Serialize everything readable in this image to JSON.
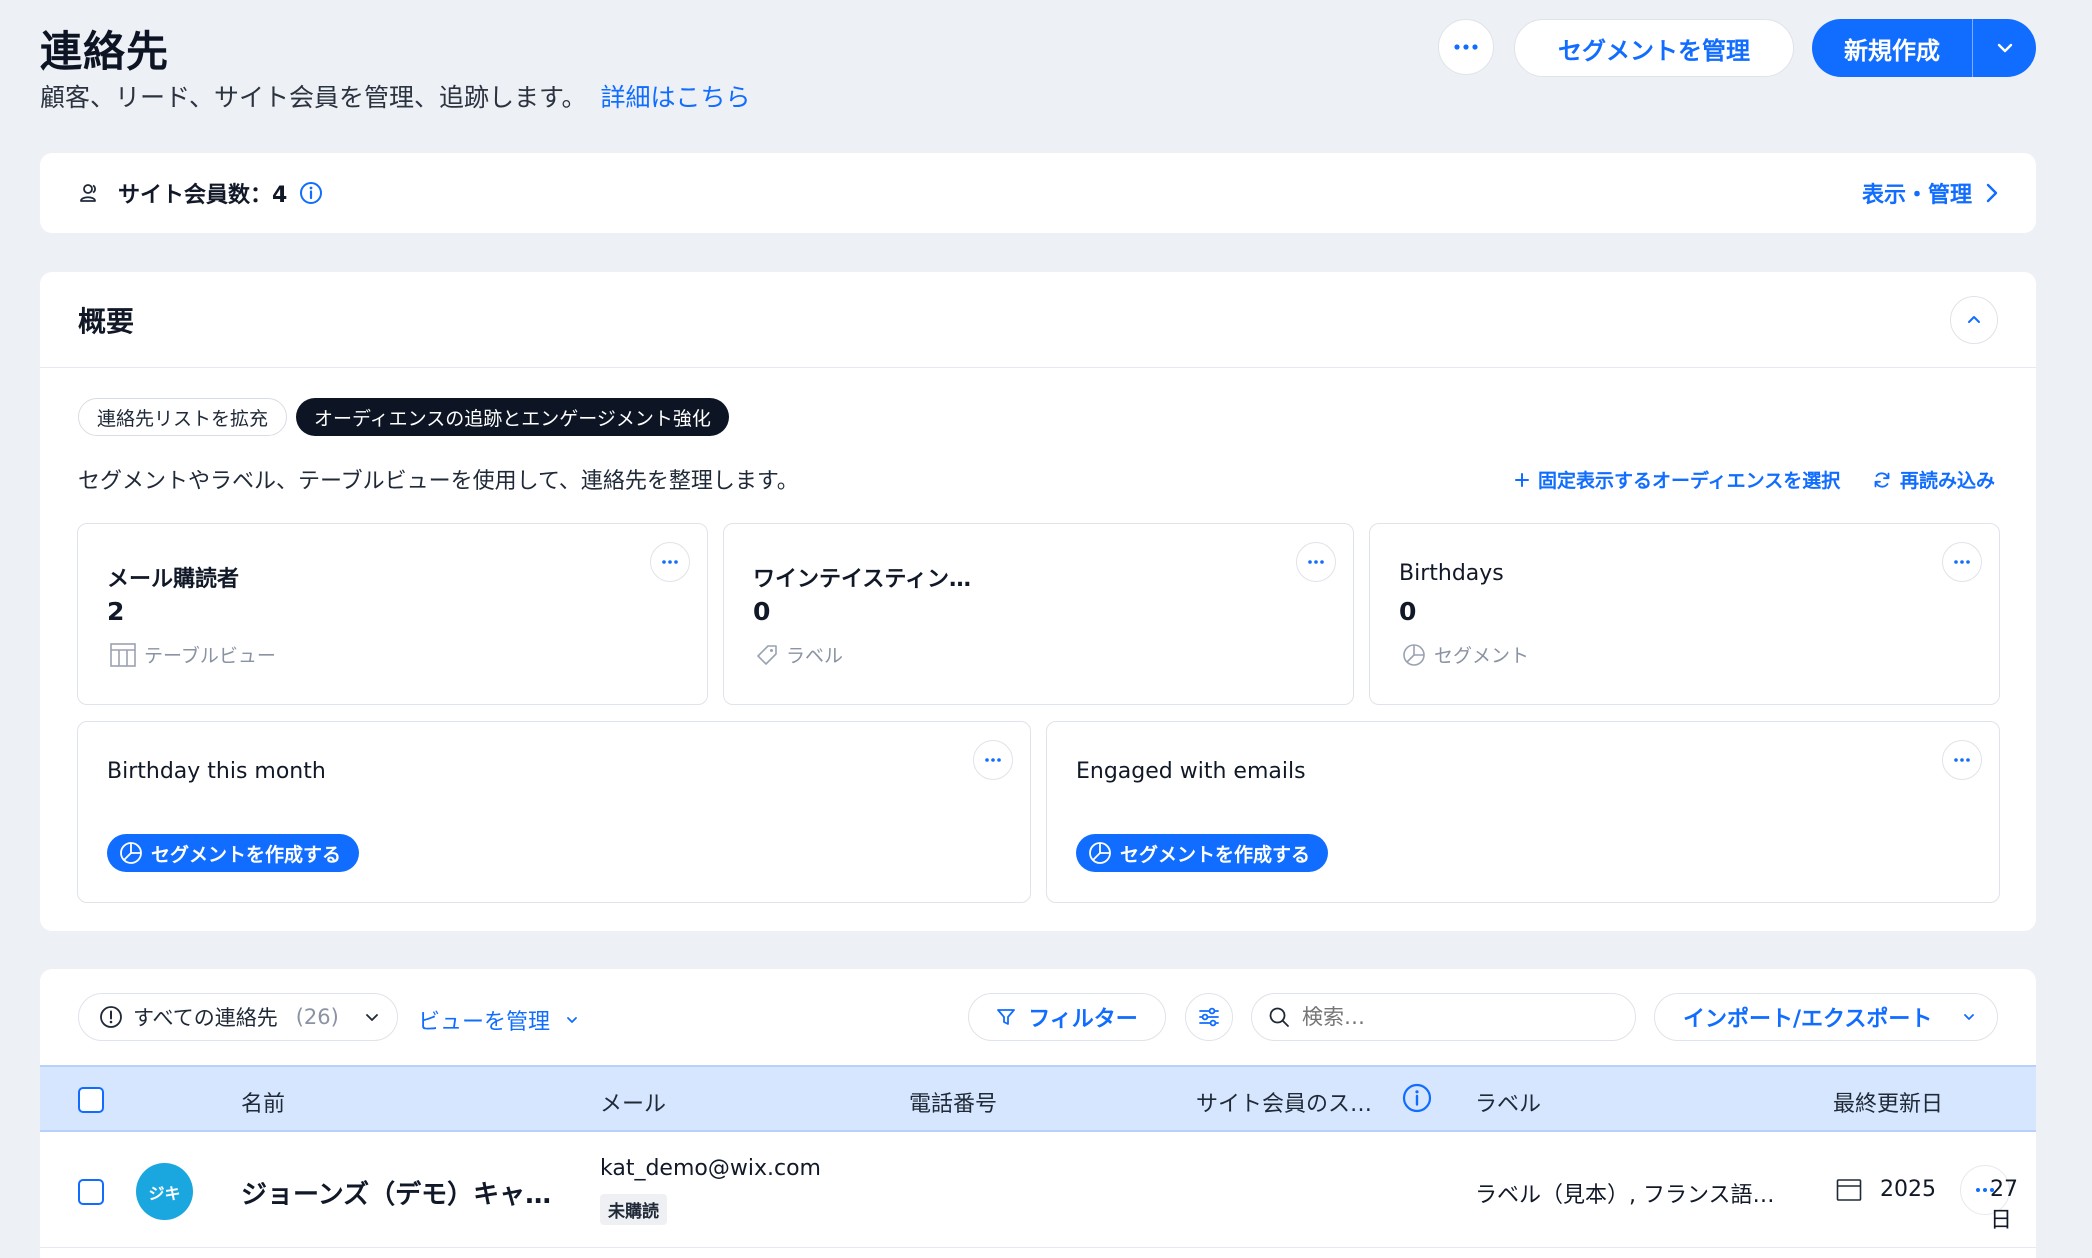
{
  "header": {
    "title": "連絡先",
    "subtitle": "顧客、リード、サイト会員を管理、追跡します。",
    "learn_more": "詳細はこちら",
    "more_icon": "ellipsis-icon",
    "manage_segments_label": "セグメントを管理",
    "new_label": "新規作成"
  },
  "members_bar": {
    "label": "サイト会員数：4",
    "view_manage_label": "表示・管理"
  },
  "overview": {
    "title": "概要",
    "chips": [
      "連絡先リストを拡充",
      "オーディエンスの追跡とエンゲージメント強化"
    ],
    "description": "セグメントやラベル、テーブルビューを使用して、連絡先を整理します。",
    "pin_audience_label": "固定表示するオーディエンスを選択",
    "reload_label": "再読み込み",
    "cards": [
      {
        "title": "メール購読者",
        "value": "2",
        "type": "テーブルビュー"
      },
      {
        "title": "ワインテイスティン…",
        "value": "0",
        "type": "ラベル"
      },
      {
        "title": "Birthdays",
        "value": "0",
        "type": "セグメント"
      }
    ],
    "segment_cards": [
      {
        "title": "Birthday this month",
        "button": "セグメントを作成する"
      },
      {
        "title": "Engaged with emails",
        "button": "セグメントを作成する"
      }
    ]
  },
  "contacts": {
    "view_select_label": "すべての連絡先",
    "view_count": "(26)",
    "manage_views_label": "ビューを管理",
    "filter_label": "フィルター",
    "search_placeholder": "検索…",
    "import_export_label": "インポート/エクスポート",
    "columns": [
      "名前",
      "メール",
      "電話番号",
      "サイト会員のス…",
      "ラベル",
      "最終更新日"
    ],
    "rows": [
      {
        "avatar_initials": "ジキ",
        "name": "ジョーンズ（デモ）キャ…",
        "email": "kat_demo@wix.com",
        "email_status": "未購読",
        "labels": "ラベル（見本）, フランス語…",
        "updated_year": "2025",
        "updated_day": "27日"
      }
    ]
  },
  "colors": {
    "accent": "#116dff",
    "background": "#edf0f4",
    "header_row": "#d6e6fe",
    "dark_chip": "#0d1424",
    "avatar": "#1aa7e0"
  }
}
